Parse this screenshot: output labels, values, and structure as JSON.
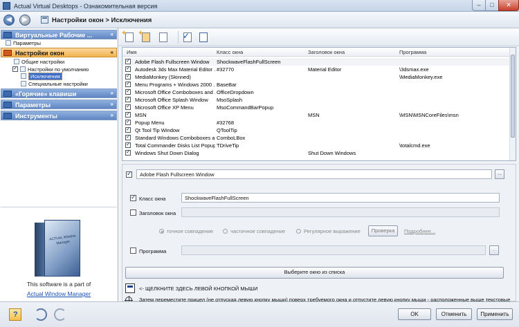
{
  "window": {
    "title": "Actual Virtual Desktops - Ознакомительная версия",
    "min_label": "–",
    "max_label": "□",
    "close_label": "✕"
  },
  "nav": {
    "back_glyph": "◀",
    "forward_glyph": "▶",
    "breadcrumb": "Настройки окон > Исключения"
  },
  "sidebar": {
    "groups": [
      {
        "label": "Виртуальные Рабочие ...",
        "chevron": "«",
        "items": [
          {
            "label": "Параметры"
          }
        ]
      },
      {
        "label": "Настройки окон",
        "chevron": "«",
        "items": [
          {
            "label": "Общие настройки"
          },
          {
            "label": "Настройки по умолчанию"
          },
          {
            "label": "Исключения"
          },
          {
            "label": "Специальные настройки"
          }
        ]
      },
      {
        "label": "«Горячие» клавиши",
        "chevron": "»"
      },
      {
        "label": "Параметры",
        "chevron": "»"
      },
      {
        "label": "Инструменты",
        "chevron": "»"
      }
    ],
    "promo_text": "This software is a part of",
    "promo_link": "Actual Window Manager",
    "box_label": "ACTUAL Window Manager"
  },
  "toolbar": {
    "icons": [
      "add-icon",
      "add-from-window-icon",
      "copy-icon",
      "check-all-icon",
      "duplicate-icon"
    ]
  },
  "grid": {
    "headers": [
      "Имя",
      "Класс окна",
      "Заголовок окна",
      "Программа"
    ],
    "rows": [
      [
        "Adobe Flash Fullscreen Window",
        "ShockwaveFlashFullScreen",
        "",
        ""
      ],
      [
        "Autodesk 3ds Max Material Editor ...",
        "#32770",
        "Material Editor",
        "\\3dsmax.exe"
      ],
      [
        "MediaMonkey (Skinned)",
        "",
        "",
        "\\MediaMonkey.exe"
      ],
      [
        "Menu Programs + Windows 2000 ...",
        "BaseBar",
        "",
        ""
      ],
      [
        "Microsoft Office Comboboxes and ...",
        "OfficeDropdown",
        "",
        ""
      ],
      [
        "Microsoft Office Splash Window",
        "MsoSplash",
        "",
        ""
      ],
      [
        "Microsoft Office XP Menu",
        "MsoCommandBarPopup",
        "",
        ""
      ],
      [
        "MSN",
        "",
        "MSN",
        "\\MSN\\MSNCoreFiles\\msn"
      ],
      [
        "Popup Menu",
        "#32768",
        "",
        ""
      ],
      [
        "Qt Tool Tip Window",
        "QToolTip",
        "",
        ""
      ],
      [
        "Standard Windows Comboboxes a...",
        "ComboLBox",
        "",
        ""
      ],
      [
        "Total Commander Disks List Popup",
        "TDriveTip",
        "",
        "\\totalcmd.exe"
      ],
      [
        "Windows Shut Down Dialog",
        "",
        "Shut Down Windows",
        ""
      ]
    ]
  },
  "detail": {
    "name_value": "Adobe Flash Fullscreen Window",
    "browse_label": "...",
    "class_label": "Класс окна",
    "class_value": "ShockwaveFlashFullScreen",
    "title_label": "Заголовок окна",
    "title_value": "",
    "radio_exact": "точное совпадение",
    "radio_partial": "частичное совпадение",
    "radio_regex": "Регулярное выражение",
    "check_button": "Проверка",
    "more_link": "Подробнее...",
    "program_label": "Программа",
    "program_value": "",
    "select_window_button": "Выберите окно из списка",
    "hint_title": "<- ЩЕЛКНИТЕ ЗДЕСЬ ЛЕВОЙ КНОПКОЙ МЫШИ",
    "hint_text": "Затем переместите прицел (не отпуская левую кнопку мыши) поверх требуемого окна и отпустите левую кнопку мыши - расположенные выше текстовые"
  },
  "footer": {
    "ok": "OK",
    "cancel": "Отменить",
    "apply": "Применить"
  }
}
